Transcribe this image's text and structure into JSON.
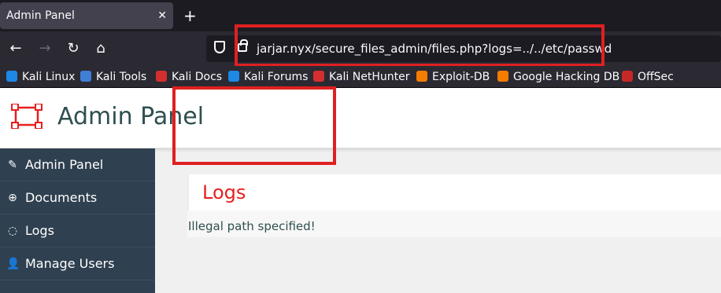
{
  "browser": {
    "tab_title": "Admin Panel",
    "tab_close": "✕",
    "new_tab": "+",
    "url": "jarjar.nyx/secure_files_admin/files.php?logs=../../etc/passwd",
    "nav": {
      "back": "←",
      "forward": "→",
      "reload": "↻",
      "home": "⌂"
    }
  },
  "bookmarks": [
    {
      "label": "Kali Linux",
      "color": "#1e88e5"
    },
    {
      "label": "Kali Tools",
      "color": "#3f7fd6"
    },
    {
      "label": "Kali Docs",
      "color": "#d32f2f"
    },
    {
      "label": "Kali Forums",
      "color": "#1e88e5"
    },
    {
      "label": "Kali NetHunter",
      "color": "#d32f2f"
    },
    {
      "label": "Exploit-DB",
      "color": "#f57c00"
    },
    {
      "label": "Google Hacking DB",
      "color": "#f57c00"
    },
    {
      "label": "OffSec",
      "color": "#c62828"
    }
  ],
  "header": {
    "title": "Admin Panel"
  },
  "sidebar": {
    "items": [
      {
        "label": "Admin Panel",
        "icon": "pencil-icon"
      },
      {
        "label": "Documents",
        "icon": "plus-circle-icon"
      },
      {
        "label": "Logs",
        "icon": "chat-icon"
      },
      {
        "label": "Manage Users",
        "icon": "user-icon"
      }
    ]
  },
  "main": {
    "title": "Logs",
    "message": "Illegal path specified!"
  },
  "colors": {
    "accent_red": "#e52020",
    "sidebar_bg": "#2f4050",
    "annotation": "#e02020"
  }
}
